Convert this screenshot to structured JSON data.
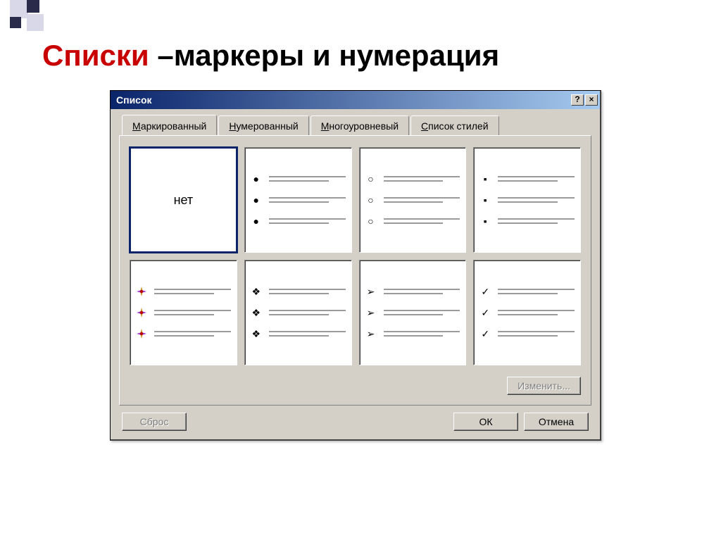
{
  "slide": {
    "title_red": "Списки",
    "title_rest": " –маркеры и нумерация"
  },
  "dialog": {
    "title": "Список",
    "help_label": "?",
    "close_label": "×",
    "tabs": {
      "bulleted": "Маркированный",
      "numbered": "Нумерованный",
      "multilevel": "Многоуровневый",
      "styles": "Список стилей",
      "bulleted_ul": "М",
      "numbered_ul": "Н",
      "multilevel_ul": "М",
      "styles_ul": "С"
    },
    "none_label": "нет",
    "buttons": {
      "modify": "Изменить...",
      "reset": "Сброс",
      "ok": "ОК",
      "cancel": "Отмена"
    },
    "bullet_options": [
      {
        "id": "none",
        "type": "none"
      },
      {
        "id": "disc",
        "type": "char",
        "char": "●"
      },
      {
        "id": "circle",
        "type": "char",
        "char": "○"
      },
      {
        "id": "square",
        "type": "char",
        "char": "▪"
      },
      {
        "id": "star4",
        "type": "svg-fourcolor"
      },
      {
        "id": "diamond",
        "type": "char",
        "char": "❖"
      },
      {
        "id": "arrowhead",
        "type": "char",
        "char": "➢"
      },
      {
        "id": "check",
        "type": "char",
        "char": "✓"
      }
    ]
  }
}
